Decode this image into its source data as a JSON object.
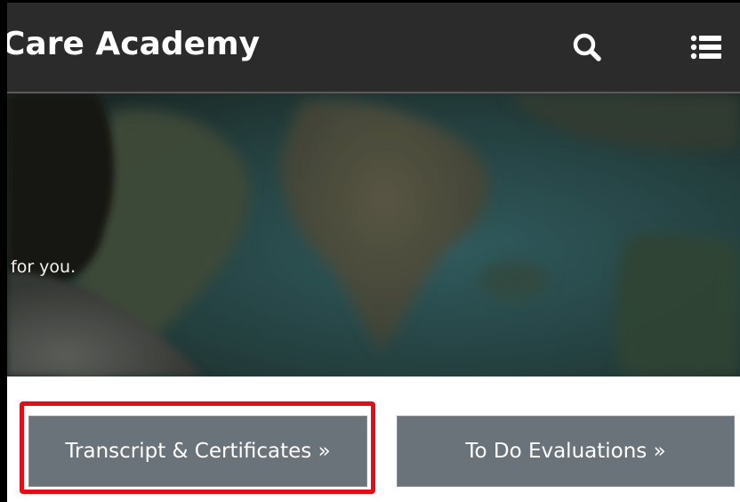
{
  "header": {
    "brand": "Care Academy",
    "search_icon": "search-icon",
    "menu_icon": "list-menu-icon"
  },
  "hero": {
    "tagline_fragment": "for you."
  },
  "actions": {
    "transcript_label": "Transcript & Certificates »",
    "todo_label": "To Do Evaluations »"
  },
  "colors": {
    "topbar": "#2c2b2c",
    "button": "#6b737a",
    "highlight": "#e10e17"
  }
}
